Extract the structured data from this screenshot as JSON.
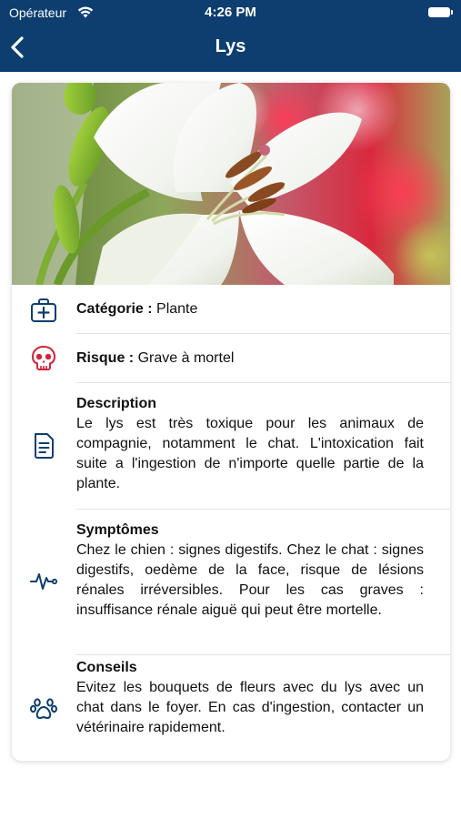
{
  "status_bar": {
    "carrier": "Opérateur",
    "time": "4:26 PM"
  },
  "nav": {
    "title": "Lys",
    "back_icon": "chevron-left-icon"
  },
  "hero": {
    "image_subject": "white lily flower photo"
  },
  "details": {
    "category": {
      "label": "Catégorie :",
      "value": "Plante",
      "icon": "medical-kit-icon"
    },
    "risk": {
      "label": "Risque :",
      "value": "Grave à mortel",
      "icon": "skull-icon",
      "color": "#d0243b"
    },
    "description": {
      "title": "Description",
      "text": "Le lys est très toxique pour les animaux de compagnie, notamment le chat. L'intoxication fait suite a l'ingestion de n'importe quelle partie de la plante.",
      "icon": "document-icon"
    },
    "symptoms": {
      "title": "Symptômes",
      "text": "Chez le chien : signes digestifs. Chez le chat : signes digestifs, oedème de la face, risque de lésions rénales irréversibles. Pour les cas graves : insuffisance rénale aiguë qui peut être mortelle.",
      "icon": "heartbeat-icon"
    },
    "advice": {
      "title": "Conseils",
      "text": "Evitez les bouquets de fleurs avec du lys avec un chat dans le foyer. En cas d'ingestion, contacter un vétérinaire rapidement.",
      "icon": "paw-icon"
    }
  },
  "colors": {
    "header_bg": "#0d3e6f",
    "icon_blue": "#0d3e6f",
    "risk_red": "#d0243b"
  }
}
